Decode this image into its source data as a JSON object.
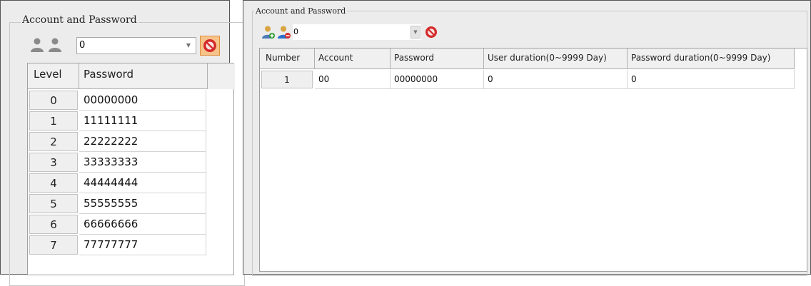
{
  "left": {
    "group_title": "Account and Password",
    "combo_value": "0",
    "columns": [
      "Level",
      "Password"
    ],
    "rows": [
      {
        "level": "0",
        "password": "00000000"
      },
      {
        "level": "1",
        "password": "11111111"
      },
      {
        "level": "2",
        "password": "22222222"
      },
      {
        "level": "3",
        "password": "33333333"
      },
      {
        "level": "4",
        "password": "44444444"
      },
      {
        "level": "5",
        "password": "55555555"
      },
      {
        "level": "6",
        "password": "66666666"
      },
      {
        "level": "7",
        "password": "77777777"
      }
    ]
  },
  "right": {
    "group_title": "Account and Password",
    "combo_value": "0",
    "columns": [
      "Number",
      "Account",
      "Password",
      "User duration(0~9999 Day)",
      "Password duration(0~9999 Day)"
    ],
    "rows": [
      {
        "number": "1",
        "account": "00",
        "password": "00000000",
        "user_duration": "0",
        "password_duration": "0"
      }
    ]
  },
  "icons": {
    "add_user": "user-add-icon",
    "remove_user": "user-remove-icon",
    "delete": "delete-icon"
  },
  "colors": {
    "panel_bg": "#ececec",
    "grid_header_bg": "#f0f0f0",
    "delete_icon_red": "#d42a2a",
    "add_user_green": "#2e9a2e",
    "remove_user_blue": "#2a6fc9",
    "left_delete_highlight": "#f6c48b"
  }
}
